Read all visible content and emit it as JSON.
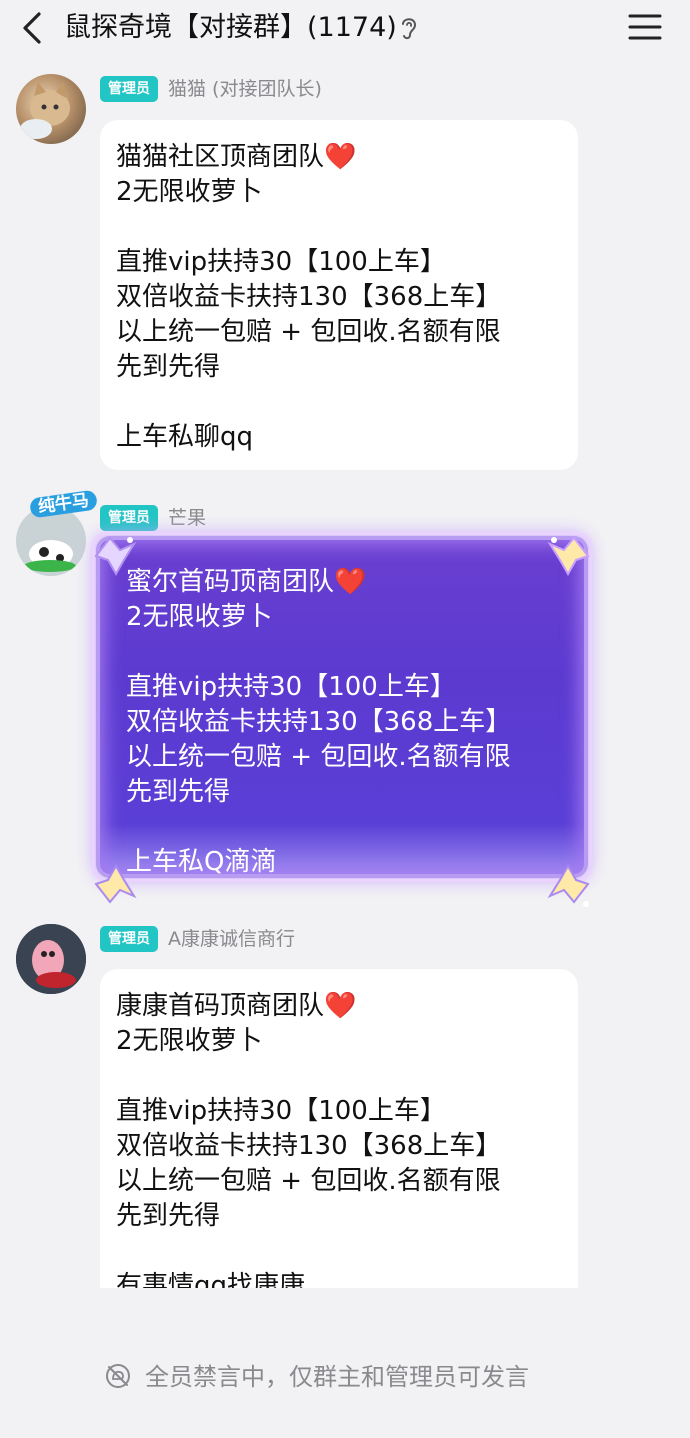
{
  "header": {
    "title": "鼠探奇境【对接群】(1174)",
    "back_icon": "chevron-left-icon",
    "ear_icon": "ear-icon",
    "menu_icon": "hamburger-menu-icon"
  },
  "messages": [
    {
      "badge": "管理员",
      "sender": "猫猫 (对接团队长)",
      "lines": [
        "猫猫社区顶商团队❤️",
        "2无限收萝卜",
        "",
        "直推vip扶持30【100上车】",
        "双倍收益卡扶持130【368上车】",
        "以上统一包赔 + 包回收.名额有限",
        "先到先得",
        "",
        "上车私聊qq"
      ]
    },
    {
      "badge": "管理员",
      "sender": "芒果",
      "avatar_text": "纯牛马",
      "lines": [
        "蜜尔首码顶商团队❤️",
        "2无限收萝卜",
        "",
        "直推vip扶持30【100上车】",
        "双倍收益卡扶持130【368上车】",
        "以上统一包赔 + 包回收.名额有限",
        "先到先得",
        "",
        "上车私Q滴滴"
      ]
    },
    {
      "badge": "管理员",
      "sender": "A康康诚信商行",
      "lines": [
        "康康首码顶商团队❤️",
        "2无限收萝卜",
        "",
        "直推vip扶持30【100上车】",
        "双倍收益卡扶持130【368上车】",
        "以上统一包赔 + 包回收.名额有限",
        "先到先得",
        "",
        "有事情qq找康康"
      ]
    }
  ],
  "footer": {
    "mute_icon": "mute-icon",
    "notice": "全员禁言中，仅群主和管理员可发言"
  },
  "colors": {
    "badge": "#21c5c4",
    "background": "#f2f2f4",
    "fancy_bubble": "#5c3ad0"
  }
}
